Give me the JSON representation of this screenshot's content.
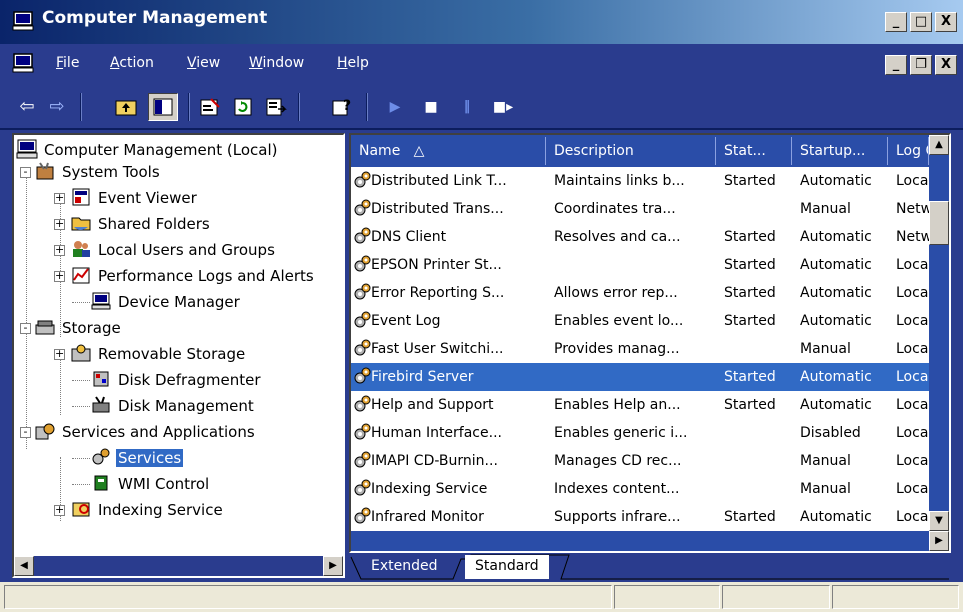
{
  "window": {
    "title": "Computer Management",
    "icon": "computer-management-icon",
    "controls": [
      "minimize",
      "restore",
      "close"
    ]
  },
  "menu": {
    "items": [
      {
        "label": "File",
        "accel": "F"
      },
      {
        "label": "Action",
        "accel": "A"
      },
      {
        "label": "View",
        "accel": "V"
      },
      {
        "label": "Window",
        "accel": "W"
      },
      {
        "label": "Help",
        "accel": "H"
      }
    ]
  },
  "toolbar": {
    "buttons": [
      "back-icon",
      "forward-icon",
      "up-one-level-icon",
      "show-hide-console-tree-icon",
      "properties-icon",
      "refresh-icon",
      "export-list-icon",
      "help-icon",
      "start-service-icon",
      "stop-service-icon",
      "pause-service-icon",
      "restart-service-icon"
    ]
  },
  "tree": {
    "items": [
      {
        "label": "Computer Management (Local)",
        "icon": "computer-icon",
        "level": 0
      },
      {
        "label": "System Tools",
        "icon": "system-tools-icon",
        "level": 1,
        "expander": "-"
      },
      {
        "label": "Event Viewer",
        "icon": "event-viewer-icon",
        "level": 2,
        "expander": "+"
      },
      {
        "label": "Shared Folders",
        "icon": "shared-folders-icon",
        "level": 2,
        "expander": "+"
      },
      {
        "label": "Local Users and Groups",
        "icon": "users-icon",
        "level": 2,
        "expander": "+"
      },
      {
        "label": "Performance Logs and Alerts",
        "icon": "performance-icon",
        "level": 2,
        "expander": "+"
      },
      {
        "label": "Device Manager",
        "icon": "device-manager-icon",
        "level": 2
      },
      {
        "label": "Storage",
        "icon": "storage-icon",
        "level": 1,
        "expander": "-"
      },
      {
        "label": "Removable Storage",
        "icon": "removable-storage-icon",
        "level": 2,
        "expander": "+"
      },
      {
        "label": "Disk Defragmenter",
        "icon": "disk-defragmenter-icon",
        "level": 2
      },
      {
        "label": "Disk Management",
        "icon": "disk-management-icon",
        "level": 2
      },
      {
        "label": "Services and Applications",
        "icon": "services-applications-icon",
        "level": 1,
        "expander": "-"
      },
      {
        "label": "Services",
        "icon": "services-gear-icon",
        "level": 2,
        "selected": true
      },
      {
        "label": "WMI Control",
        "icon": "wmi-control-icon",
        "level": 2
      },
      {
        "label": "Indexing Service",
        "icon": "indexing-service-icon",
        "level": 2,
        "expander": "+"
      }
    ]
  },
  "services": {
    "columns": [
      "Name",
      "Description",
      "Stat...",
      "Startup...",
      "Log C"
    ],
    "sort_indicator": "△",
    "rows": [
      {
        "name": "Distributed Link T...",
        "description": "Maintains links b...",
        "status": "Started",
        "startup": "Automatic",
        "logon": "Local"
      },
      {
        "name": "Distributed Trans...",
        "description": "Coordinates tra...",
        "status": "",
        "startup": "Manual",
        "logon": "Netw"
      },
      {
        "name": "DNS Client",
        "description": "Resolves and ca...",
        "status": "Started",
        "startup": "Automatic",
        "logon": "Netw"
      },
      {
        "name": "EPSON Printer St...",
        "description": "",
        "status": "Started",
        "startup": "Automatic",
        "logon": "Local"
      },
      {
        "name": "Error Reporting S...",
        "description": "Allows error rep...",
        "status": "Started",
        "startup": "Automatic",
        "logon": "Local"
      },
      {
        "name": "Event Log",
        "description": "Enables event lo...",
        "status": "Started",
        "startup": "Automatic",
        "logon": "Local"
      },
      {
        "name": "Fast User Switchi...",
        "description": "Provides manag...",
        "status": "",
        "startup": "Manual",
        "logon": "Local"
      },
      {
        "name": "Firebird Server",
        "description": "",
        "status": "Started",
        "startup": "Automatic",
        "logon": "Local",
        "selected": true
      },
      {
        "name": "Help and Support",
        "description": "Enables Help an...",
        "status": "Started",
        "startup": "Automatic",
        "logon": "Local"
      },
      {
        "name": "Human Interface...",
        "description": "Enables generic i...",
        "status": "",
        "startup": "Disabled",
        "logon": "Local"
      },
      {
        "name": "IMAPI CD-Burnin...",
        "description": "Manages CD rec...",
        "status": "",
        "startup": "Manual",
        "logon": "Local"
      },
      {
        "name": "Indexing Service",
        "description": "Indexes content...",
        "status": "",
        "startup": "Manual",
        "logon": "Local"
      },
      {
        "name": "Infrared Monitor",
        "description": "Supports infrare...",
        "status": "Started",
        "startup": "Automatic",
        "logon": "Local"
      }
    ]
  },
  "tabs": [
    {
      "label": "Extended",
      "active": false
    },
    {
      "label": "Standard",
      "active": true
    }
  ],
  "colors": {
    "selection": "#316ac5",
    "chrome": "#2a3c8e",
    "title_gradient_start": "#0a246a",
    "title_gradient_end": "#a6caf0"
  }
}
